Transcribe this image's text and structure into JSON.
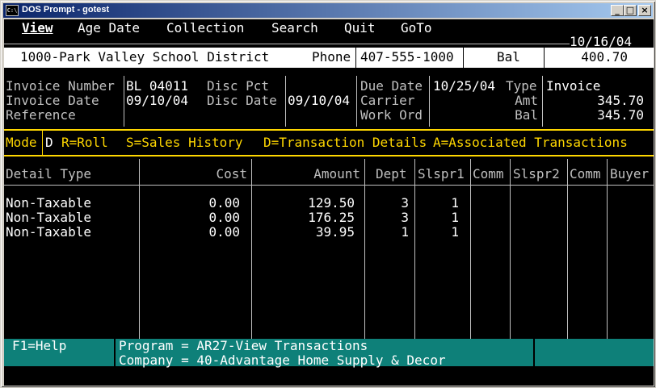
{
  "window": {
    "title": "DOS Prompt - gotest",
    "icon": "C:\\"
  },
  "titlebar_buttons": [
    "_",
    "□",
    "×"
  ],
  "menu": [
    "View",
    "Age Date",
    "Collection",
    "Search",
    "Quit",
    "GoTo"
  ],
  "date": "10/16/04",
  "account": {
    "name": "1000-Park Valley School District",
    "phone_label": "Phone",
    "phone": "407-555-1000",
    "bal_label": "Bal",
    "bal": "400.70"
  },
  "invoice": {
    "number_label": "Invoice Number",
    "number": "BL 04011",
    "date_label": "Invoice Date",
    "date": "09/10/04",
    "reference_label": "Reference",
    "disc_pct_label": "Disc Pct",
    "disc_date_label": "Disc Date",
    "disc_date": "09/10/04",
    "due_date_label": "Due Date",
    "due_date": "10/25/04",
    "carrier_label": "Carrier",
    "work_ord_label": "Work Ord",
    "type_label": "Type",
    "type": "Invoice",
    "amt_label": "Amt",
    "amt": "345.70",
    "bal_label": "Bal",
    "bal": "345.70"
  },
  "mode": {
    "label": "Mode",
    "value": "D",
    "options": [
      "R=Roll",
      "S=Sales History",
      "D=Transaction Details",
      "A=Associated Transactions"
    ]
  },
  "table": {
    "headers": [
      "Detail Type",
      "Cost",
      "Amount",
      "Dept",
      "Slspr1",
      "Comm",
      "Slspr2",
      "Comm",
      "Buyer"
    ],
    "rows": [
      [
        "Non-Taxable",
        "0.00",
        "129.50",
        "3",
        "1"
      ],
      [
        "Non-Taxable",
        "0.00",
        "176.25",
        "3",
        "1"
      ],
      [
        "Non-Taxable",
        "0.00",
        "39.95",
        "1",
        "1"
      ]
    ]
  },
  "footer": {
    "help": "F1=Help",
    "program": "Program = AR27-View Transactions",
    "company": "Company = 40-Advantage Home Supply & Decor"
  }
}
